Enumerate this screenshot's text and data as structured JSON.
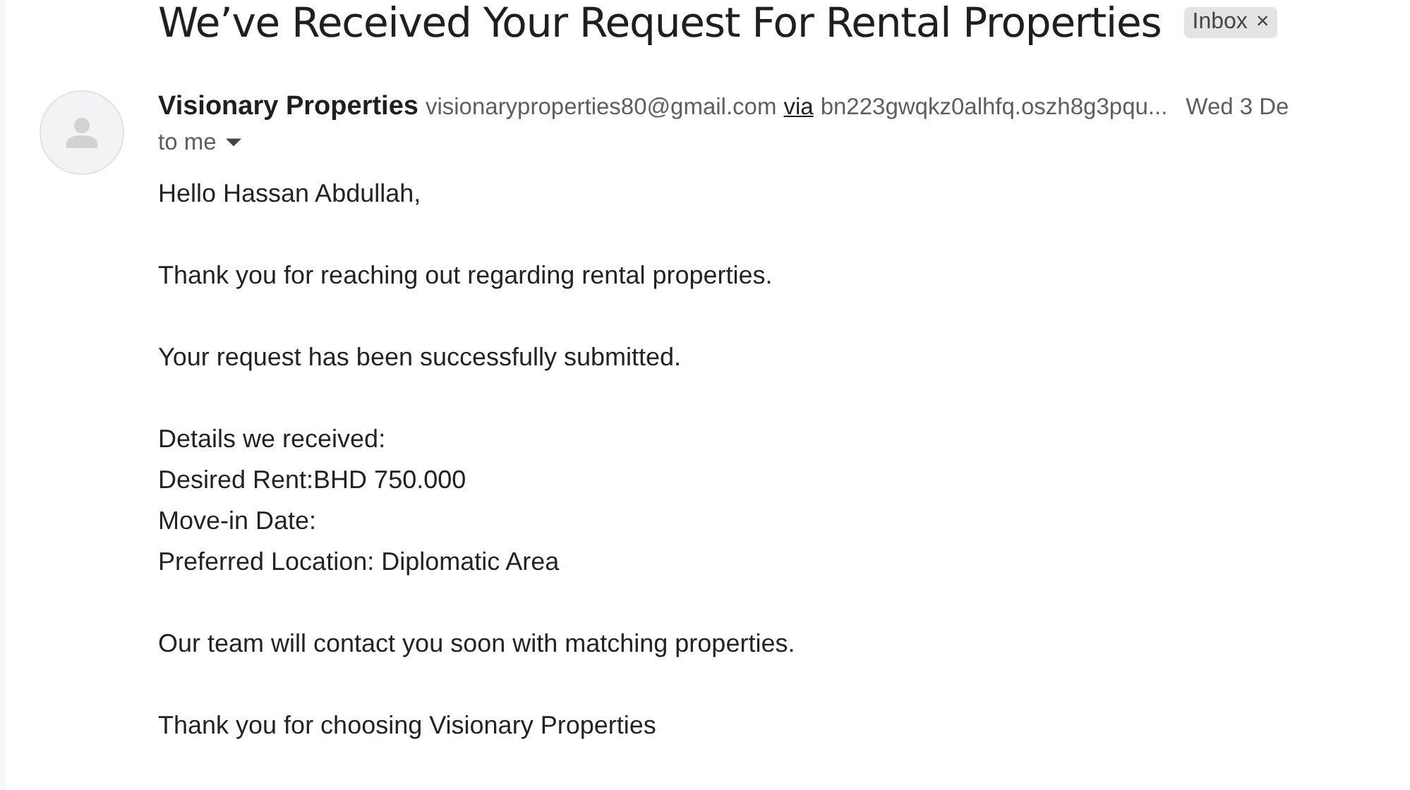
{
  "subject": "We’ve Received Your Request For Rental Properties",
  "label": {
    "text": "Inbox",
    "remove": "×"
  },
  "sender": {
    "name": "Visionary Properties",
    "email": "visionaryproperties80@gmail.com",
    "via_label": "via",
    "via": "bn223gwqkz0alhfq.oszh8g3pqu...",
    "date": "Wed 3 De"
  },
  "recipient": "to me",
  "body": [
    [
      "Hello Hassan Abdullah,"
    ],
    [
      "Thank you for reaching out regarding rental properties."
    ],
    [
      "Your request has been successfully submitted."
    ],
    [
      "Details we received:",
      "Desired Rent:BHD 750.000",
      "Move-in Date:",
      "Preferred Location: Diplomatic Area"
    ],
    [
      "Our team will contact you soon with matching properties."
    ],
    [
      "Thank you for choosing Visionary Properties"
    ]
  ]
}
